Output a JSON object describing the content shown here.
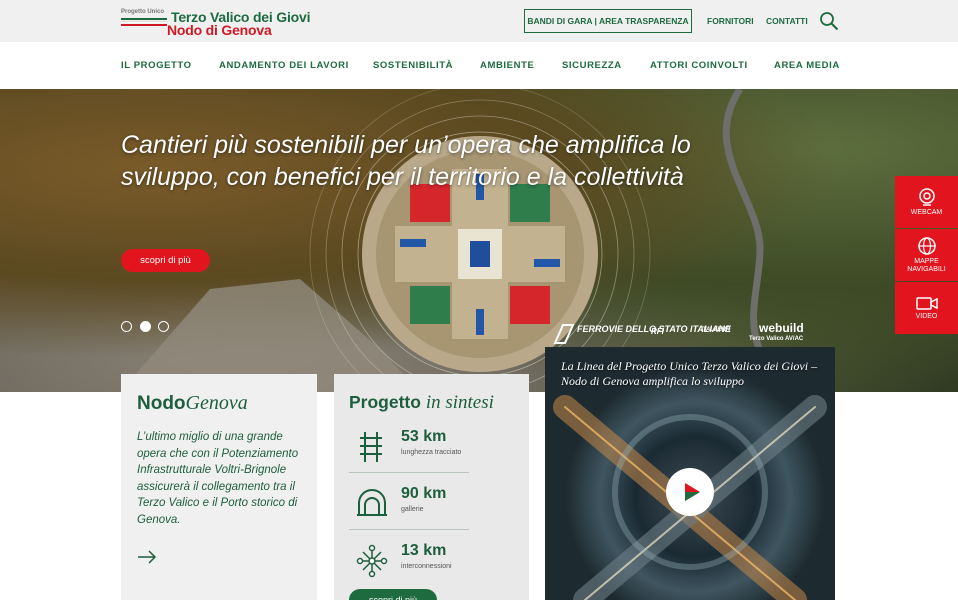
{
  "header": {
    "logo_small": "Progetto Unico",
    "logo_line1": "Terzo Valico dei Giovi",
    "logo_line2": "Nodo di Genova",
    "bandi_label": "BANDI DI GARA | AREA TRASPARENZA",
    "fornitori_label": "FORNITORI",
    "contatti_label": "CONTATTI",
    "search_icon": "search-icon"
  },
  "nav": {
    "items": [
      "IL PROGETTO",
      "ANDAMENTO DEI LAVORI",
      "SOSTENIBILITÀ",
      "AMBIENTE",
      "SICUREZZA",
      "ATTORI COINVOLTI",
      "AREA MEDIA"
    ]
  },
  "hero": {
    "title": "Cantieri più sostenibili per un’opera che amplifica lo sviluppo, con benefici per il territorio e la collettività",
    "button_label": "scopri di più",
    "slide_count": 3,
    "active_slide": 2,
    "partners": [
      "FERROVIE DELLO STATO ITALIANE",
      "RFI",
      "ITALFERR",
      "webuild",
      "Terzo Valico AV/AC"
    ]
  },
  "side_widget": {
    "items": [
      {
        "label": "WEBCAM",
        "icon": "webcam-icon"
      },
      {
        "label": "MAPPE NAVIGABILI",
        "icon": "globe-icon"
      },
      {
        "label": "VIDEO",
        "icon": "video-camera-icon"
      }
    ]
  },
  "card_nodo": {
    "title_bold": "Nodo",
    "title_italic": "Genova",
    "text": "L’ultimo miglio di una grande opera che con il Potenziamento Infrastrutturale Voltri-Brignole assicurerà il collegamento tra il Terzo Valico e il Porto storico di Genova.",
    "arrow_icon": "arrow-right-icon"
  },
  "card_sintesi": {
    "title_bold": "Progetto",
    "title_italic": "in sintesi",
    "stats": [
      {
        "value": "53 km",
        "label": "lunghezza tracciato",
        "icon": "railway-track-icon"
      },
      {
        "value": "90 km",
        "label": "gallerie",
        "icon": "tunnel-icon"
      },
      {
        "value": "13 km",
        "label": "interconnessioni",
        "icon": "network-icon"
      }
    ],
    "button_label": "scopri di più"
  },
  "video": {
    "title": "La Linea del Progetto Unico Terzo Valico dei Giovi – Nodo di Genova amplifica lo sviluppo",
    "play_icon": "play-icon"
  },
  "colors": {
    "brand_green": "#1d6b3f",
    "brand_red": "#e2151f",
    "topbar_bg": "#f0f0f0"
  }
}
